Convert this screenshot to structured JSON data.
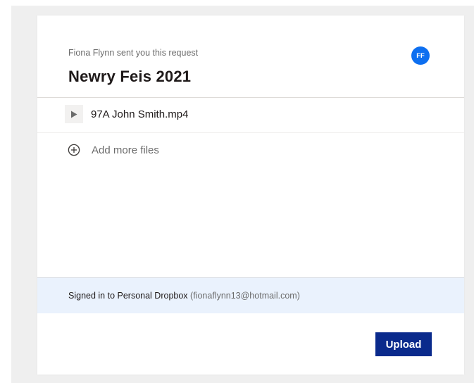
{
  "request": {
    "sender_text": "Fiona Flynn sent you this request",
    "title": "Newry Feis 2021",
    "avatar_initials": "FF"
  },
  "files": [
    {
      "name": "97A John Smith.mp4",
      "icon": "play-icon"
    }
  ],
  "add_files": {
    "label": "Add more files",
    "icon": "add-circle-icon"
  },
  "account": {
    "signed_in_label": "Signed in to Personal Dropbox",
    "email": "(fionaflynn13@hotmail.com)"
  },
  "actions": {
    "upload_label": "Upload"
  },
  "colors": {
    "accent_button": "#0a2a8c",
    "avatar": "#0d6ff0",
    "signed_bar": "#eaf2fd"
  }
}
